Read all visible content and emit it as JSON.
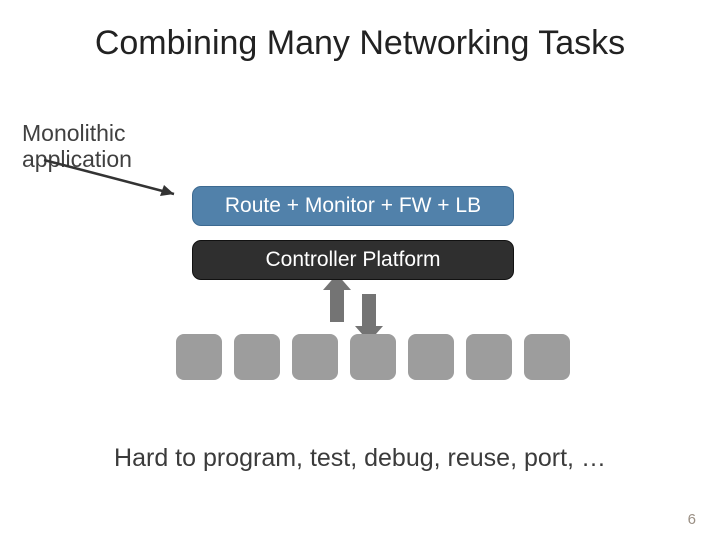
{
  "title": "Combining Many Networking Tasks",
  "monolithic_label": "Monolithic\napplication",
  "app_box": "Route + Monitor + FW + LB",
  "controller_box": "Controller Platform",
  "footer": "Hard to program, test, debug, reuse, port, …",
  "page_number": "6",
  "colors": {
    "app_box_bg": "#5181aa",
    "controller_bg": "#2f2f2f",
    "node_bg": "#9d9d9d"
  },
  "node_count": 7
}
